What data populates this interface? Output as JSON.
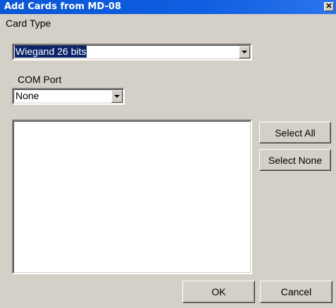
{
  "window": {
    "title": "Add Cards from MD-08",
    "close_glyph": "✕"
  },
  "card_type": {
    "label": "Card Type",
    "selected": "Wiegand 26 bits"
  },
  "com_port": {
    "label": "COM Port",
    "selected": "None"
  },
  "buttons": {
    "select_all": "Select All",
    "select_none": "Select None",
    "ok": "OK",
    "cancel": "Cancel"
  }
}
